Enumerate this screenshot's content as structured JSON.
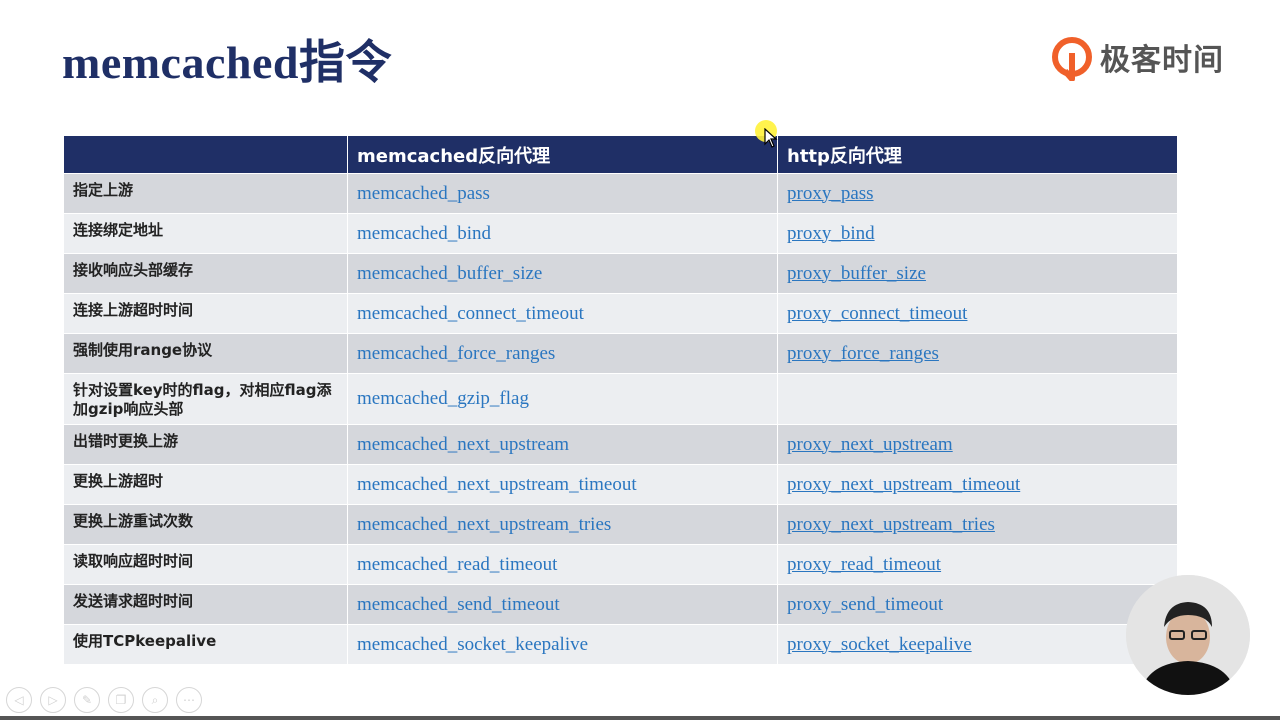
{
  "slide": {
    "title": "memcached指令",
    "logo_text": "极客时间"
  },
  "table": {
    "headers": [
      "",
      "memcached反向代理",
      "http反向代理"
    ],
    "rows": [
      {
        "label": "指定上游",
        "memcached": "memcached_pass",
        "http": "proxy_pass",
        "http_link": true
      },
      {
        "label": "连接绑定地址",
        "memcached": "memcached_bind",
        "http": "proxy_bind",
        "http_link": true
      },
      {
        "label": "接收响应头部缓存",
        "memcached": "memcached_buffer_size",
        "http": "proxy_buffer_size",
        "http_link": true
      },
      {
        "label": "连接上游超时时间",
        "memcached": "memcached_connect_timeout",
        "http": "proxy_connect_timeout",
        "http_link": true
      },
      {
        "label": "强制使用range协议",
        "memcached": "memcached_force_ranges",
        "http": "proxy_force_ranges",
        "http_link": true
      },
      {
        "label": "针对设置key时的flag，对相应flag添加gzip响应头部",
        "memcached": "memcached_gzip_flag",
        "http": "",
        "http_link": false
      },
      {
        "label": "出错时更换上游",
        "memcached": "memcached_next_upstream",
        "http": "proxy_next_upstream",
        "http_link": true
      },
      {
        "label": "更换上游超时",
        "memcached": "memcached_next_upstream_timeout",
        "http": "proxy_next_upstream_timeout",
        "http_link": true
      },
      {
        "label": "更换上游重试次数",
        "memcached": "memcached_next_upstream_tries",
        "http": "proxy_next_upstream_tries",
        "http_link": true
      },
      {
        "label": "读取响应超时时间",
        "memcached": "memcached_read_timeout",
        "http": "proxy_read_timeout",
        "http_link": true
      },
      {
        "label": "发送请求超时时间",
        "memcached": "memcached_send_timeout",
        "http": "proxy_send_timeout",
        "http_link": false
      },
      {
        "label": "使用TCPkeepalive",
        "memcached": "memcached_socket_keepalive",
        "http": "proxy_socket_keepalive",
        "http_link": true
      }
    ]
  },
  "toolbar": {
    "icons": [
      "prev-icon",
      "next-icon",
      "pen-icon",
      "copy-icon",
      "zoom-icon",
      "more-icon"
    ]
  },
  "colors": {
    "header_bg": "#1f2f66",
    "title": "#1f2f66",
    "directive": "#2a76c0",
    "row_dark": "#d5d7dc",
    "row_light": "#eceef1",
    "logo_orange": "#f0602a"
  }
}
